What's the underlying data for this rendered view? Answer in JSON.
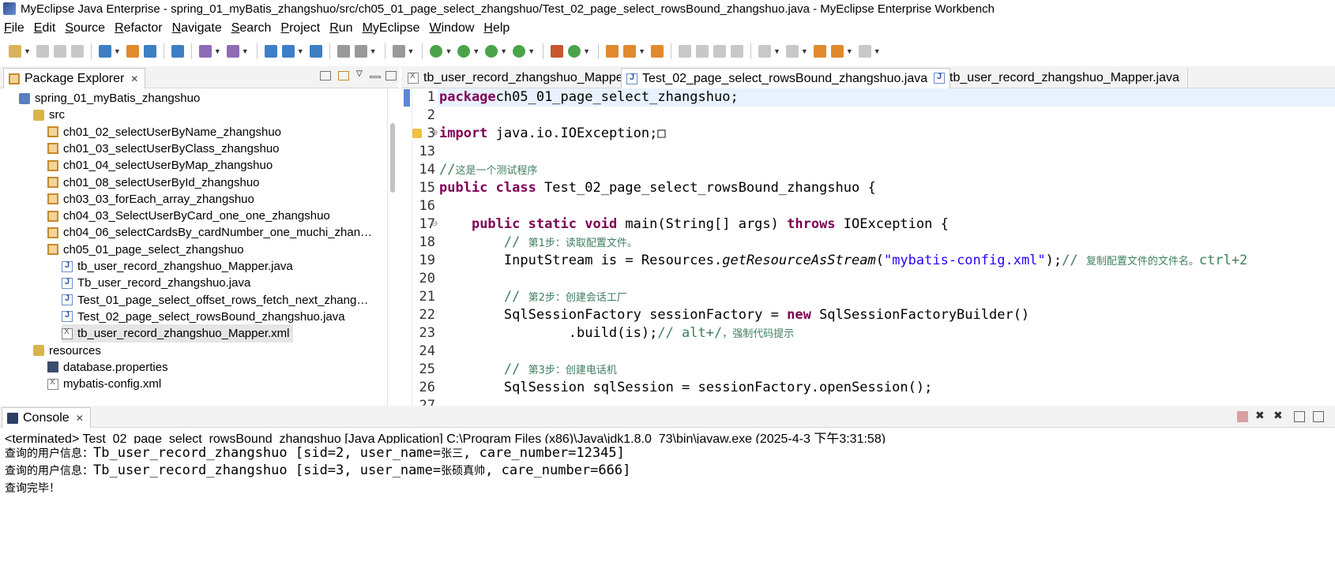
{
  "window": {
    "title": "MyEclipse Java Enterprise - spring_01_myBatis_zhangshuo/src/ch05_01_page_select_zhangshuo/Test_02_page_select_rowsBound_zhangshuo.java - MyEclipse Enterprise Workbench"
  },
  "menu": [
    "File",
    "Edit",
    "Source",
    "Refactor",
    "Navigate",
    "Search",
    "Project",
    "Run",
    "MyEclipse",
    "Window",
    "Help"
  ],
  "package_explorer": {
    "title": "Package Explorer",
    "items": [
      {
        "label": "spring_01_myBatis_zhangshuo",
        "icon": "project-icon"
      },
      {
        "label": "src",
        "icon": "source-folder-icon"
      },
      {
        "label": "ch01_02_selectUserByName_zhangshuo",
        "icon": "package-icon"
      },
      {
        "label": "ch01_03_selectUserByClass_zhangshuo",
        "icon": "package-icon"
      },
      {
        "label": "ch01_04_selectUserByMap_zhangshuo",
        "icon": "package-icon"
      },
      {
        "label": "ch01_08_selectUserById_zhangshuo",
        "icon": "package-icon"
      },
      {
        "label": "ch03_03_forEach_array_zhangshuo",
        "icon": "package-icon"
      },
      {
        "label": "ch04_03_SelectUserByCard_one_one_zhangshuo",
        "icon": "package-icon"
      },
      {
        "label": "ch04_06_selectCardsBy_cardNumber_one_muchi_zhan…",
        "icon": "package-icon"
      },
      {
        "label": "ch05_01_page_select_zhangshuo",
        "icon": "package-icon"
      },
      {
        "label": "tb_user_record_zhangshuo_Mapper.java",
        "icon": "java-file-icon"
      },
      {
        "label": "Tb_user_record_zhangshuo.java",
        "icon": "java-file-icon"
      },
      {
        "label": "Test_01_page_select_offset_rows_fetch_next_zhang…",
        "icon": "java-file-icon"
      },
      {
        "label": "Test_02_page_select_rowsBound_zhangshuo.java",
        "icon": "java-file-icon"
      },
      {
        "label": "tb_user_record_zhangshuo_Mapper.xml",
        "icon": "xml-file-icon",
        "selected": true
      },
      {
        "label": "resources",
        "icon": "source-folder-icon"
      },
      {
        "label": "database.properties",
        "icon": "properties-file-icon"
      },
      {
        "label": "mybatis-config.xml",
        "icon": "xml-file-icon"
      }
    ]
  },
  "editor": {
    "tabs": [
      {
        "label": "tb_user_record_zhangshuo_Mapper.xml",
        "icon": "xml-file-icon",
        "active": false
      },
      {
        "label": "Test_02_page_select_rowsBound_zhangshuo.java",
        "icon": "java-file-icon",
        "active": true
      },
      {
        "label": "tb_user_record_zhangshuo_Mapper.java",
        "icon": "java-file-icon",
        "active": false
      }
    ],
    "lines": [
      {
        "n": "1",
        "parts": [
          [
            "kw",
            "package"
          ],
          [
            "",
            "ch05_01_page_select_zhangshuo;"
          ]
        ]
      },
      {
        "n": "2",
        "parts": []
      },
      {
        "n": "3",
        "parts": [
          [
            "kw",
            "import"
          ],
          [
            "",
            " java.io.IOException;□"
          ]
        ]
      },
      {
        "n": "13",
        "parts": []
      },
      {
        "n": "14",
        "parts": [
          [
            "cm",
            "//"
          ],
          [
            "cmz",
            "这是一个测试程序"
          ]
        ]
      },
      {
        "n": "15",
        "parts": [
          [
            "kw",
            "public class"
          ],
          [
            "",
            " Test_02_page_select_rowsBound_zhangshuo {"
          ]
        ]
      },
      {
        "n": "16",
        "parts": []
      },
      {
        "n": "17",
        "parts": [
          [
            "",
            "    "
          ],
          [
            "kw",
            "public static void"
          ],
          [
            "",
            " main(String[] args) "
          ],
          [
            "kw",
            "throws"
          ],
          [
            "",
            " IOException {"
          ]
        ]
      },
      {
        "n": "18",
        "parts": [
          [
            "",
            "        "
          ],
          [
            "cm",
            "// "
          ],
          [
            "cmz",
            "第1步：读取配置文件。"
          ]
        ]
      },
      {
        "n": "19",
        "parts": [
          [
            "",
            "        InputStream is = Resources."
          ],
          [
            "it",
            "getResourceAsStream"
          ],
          [
            "",
            "("
          ],
          [
            "str",
            "\"mybatis-config.xml\""
          ],
          [
            "",
            ");"
          ],
          [
            "cm",
            "// "
          ],
          [
            "cmz",
            "复制配置文件的文件名。"
          ],
          [
            "cm",
            "ctrl+2"
          ]
        ]
      },
      {
        "n": "20",
        "parts": []
      },
      {
        "n": "21",
        "parts": [
          [
            "",
            "        "
          ],
          [
            "cm",
            "// "
          ],
          [
            "cmz",
            "第2步：创建会话工厂"
          ]
        ]
      },
      {
        "n": "22",
        "parts": [
          [
            "",
            "        SqlSessionFactory sessionFactory = "
          ],
          [
            "kw",
            "new"
          ],
          [
            "",
            " SqlSessionFactoryBuilder()"
          ]
        ]
      },
      {
        "n": "23",
        "parts": [
          [
            "",
            "                .build(is);"
          ],
          [
            "cm",
            "// alt+/"
          ],
          [
            "cmz",
            "，强制代码提示"
          ]
        ]
      },
      {
        "n": "24",
        "parts": []
      },
      {
        "n": "25",
        "parts": [
          [
            "",
            "        "
          ],
          [
            "cm",
            "// "
          ],
          [
            "cmz",
            "第3步：创建电话机"
          ]
        ]
      },
      {
        "n": "26",
        "parts": [
          [
            "",
            "        SqlSession sqlSession = sessionFactory.openSession();"
          ]
        ]
      },
      {
        "n": "27",
        "parts": []
      }
    ]
  },
  "console": {
    "title": "Console",
    "status": "<terminated> Test_02_page_select_rowsBound_zhangshuo [Java Application] C:\\Program Files (x86)\\Java\\jdk1.8.0_73\\bin\\javaw.exe (2025-4-3 下午3:31:58)",
    "lines": [
      [
        [
          "z",
          "查询的用户信息："
        ],
        [
          "m",
          "Tb_user_record_zhangshuo [sid=2, user_name="
        ],
        [
          "z",
          "张三"
        ],
        [
          "m",
          ", care_number=12345]"
        ]
      ],
      [
        [
          "z",
          "查询的用户信息："
        ],
        [
          "m",
          "Tb_user_record_zhangshuo [sid=3, user_name="
        ],
        [
          "z",
          "张硕真帅"
        ],
        [
          "m",
          ", care_number=666]"
        ]
      ],
      [
        [
          "z",
          "查询完毕！"
        ]
      ]
    ]
  }
}
